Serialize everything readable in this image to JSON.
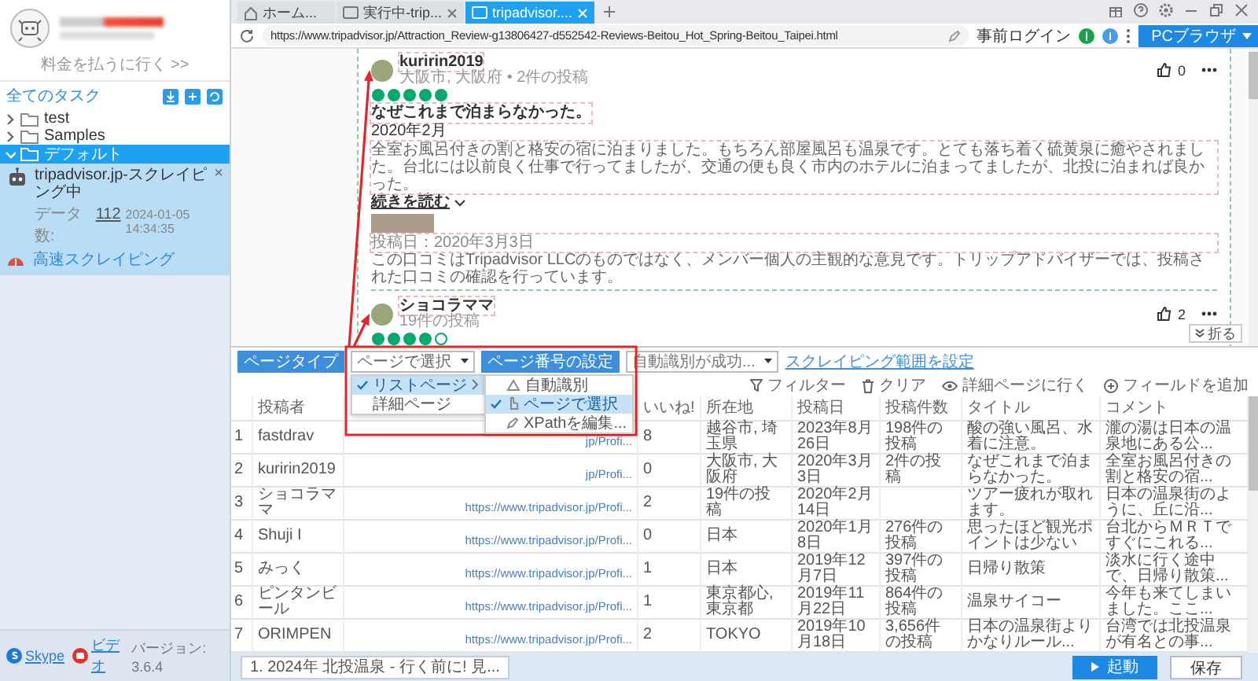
{
  "sidebar": {
    "account_link": "料金を払うに行く >>",
    "section_title": "全てのタスク",
    "folders": [
      {
        "label": "test",
        "expanded": false,
        "selected": false
      },
      {
        "label": "Samples",
        "expanded": false,
        "selected": false
      },
      {
        "label": "デフォルト",
        "expanded": true,
        "selected": true,
        "tasks": [
          {
            "title": "tripadvisor.jp-スクレイピング中",
            "data_label": "データ数:",
            "data_count": "112",
            "time": "2024-01-05 14:34:35",
            "mode": "高速スクレイピング",
            "close": "×"
          }
        ]
      }
    ],
    "footer": {
      "links": [
        {
          "kind": "skype",
          "label": "Skype"
        },
        {
          "kind": "video",
          "label": "ビデオ"
        }
      ],
      "version": "バージョン: 3.6.4"
    }
  },
  "browser": {
    "tabs": [
      {
        "kind": "home",
        "label": "ホーム...",
        "selected": false,
        "closable": false
      },
      {
        "kind": "page",
        "label": "実行中-trip...",
        "selected": false,
        "closable": true
      },
      {
        "kind": "page",
        "label": "tripadvisor....",
        "selected": true,
        "closable": true
      }
    ],
    "url": "https://www.tripadvisor.jp/Attraction_Review-g13806427-d552542-Reviews-Beitou_Hot_Spring-Beitou_Taipei.html",
    "login_button": "事前ログイン",
    "mode_button": "PCブラウザ"
  },
  "page": {
    "reviews": [
      {
        "author": "kuririn2019",
        "meta": "大阪市, 大阪府 • 2件の投稿",
        "likes": "0",
        "stars": 5,
        "title": "なぜこれまで泊まらなかった。",
        "date": "2020年2月",
        "body": "全室お風呂付きの割と格安の宿に泊まりました。もちろん部屋風呂も温泉です。とても落ち着く硫黄泉に癒やされました。台北には以前良く仕事で行ってましたが、交通の便も良く市内のホテルに泊まってましたが、北投に泊まれば良かった。",
        "read_more": "続きを読む",
        "photo": true,
        "posted": "投稿日：2020年3月3日",
        "disclaimer": "この口コミはTripadvisor LLCのものではなく、メンバー個人の主観的な意見です。トリップアドバイザーでは、投稿された口コミの確認を行っています。"
      },
      {
        "author": "ショコラママ",
        "meta": "19件の投稿",
        "likes": "2",
        "stars": 4
      }
    ],
    "collapse_button": "折る"
  },
  "panel": {
    "page_type_button": "ページタイプ",
    "page_type_select": "ページで選択",
    "page_number_button": "ページ番号の設定",
    "page_number_select": "自動識別が成功...",
    "range_link": "スクレイピング範囲を設定",
    "actions": [
      {
        "kind": "filter",
        "label": "フィルター"
      },
      {
        "kind": "clear",
        "label": "クリア"
      },
      {
        "kind": "detail",
        "label": "詳細ページに行く"
      },
      {
        "kind": "add",
        "label": "フィールドを追加"
      }
    ],
    "menu": [
      {
        "label": "リストページ",
        "selected": true,
        "has_submenu": true
      },
      {
        "label": "詳細ページ",
        "selected": false,
        "has_submenu": false
      }
    ],
    "submenu": [
      {
        "kind": "auto",
        "label": "自動識別",
        "selected": false
      },
      {
        "kind": "click",
        "label": "ページで選択",
        "selected": true
      },
      {
        "kind": "edit",
        "label": "XPathを編集...",
        "selected": false
      }
    ],
    "columns": [
      {
        "kind": "index"
      },
      {
        "kind": "text",
        "label": "投稿者"
      },
      {
        "kind": "link"
      },
      {
        "kind": "text",
        "label": "いいね!"
      },
      {
        "kind": "text",
        "label": "所在地"
      },
      {
        "kind": "text",
        "label": "投稿日"
      },
      {
        "kind": "text",
        "label": "投稿件数"
      },
      {
        "kind": "text",
        "label": "タイトル"
      },
      {
        "kind": "text",
        "label": "コメント"
      }
    ],
    "rows": [
      {
        "cells": [
          "1",
          "fastdrav",
          "jp/Profi...",
          "8",
          "越谷市, 埼玉県",
          "2023年8月26日",
          "198件の投稿",
          "酸の強い風呂、水着に注意。",
          "瀧の湯は日本の温泉地にある公..."
        ]
      },
      {
        "cells": [
          "2",
          "kuririn2019",
          "jp/Profi...",
          "0",
          "大阪市, 大阪府",
          "2020年3月3日",
          "2件の投稿",
          "なぜこれまで泊まらなかった。",
          "全室お風呂付きの割と格安の宿..."
        ]
      },
      {
        "cells": [
          "3",
          "ショコラママ",
          "https://www.tripadvisor.jp/Profi...",
          "2",
          "19件の投稿",
          "2020年2月14日",
          null,
          "ツアー疲れが取れます。",
          "日本の温泉街のように、丘に沿..."
        ]
      },
      {
        "cells": [
          "4",
          "Shuji I",
          "https://www.tripadvisor.jp/Profi...",
          "0",
          "日本",
          "2020年1月8日",
          "276件の投稿",
          "思ったほど観光ポイントは少ない",
          "台北からＭＲＴですぐにこれる..."
        ]
      },
      {
        "cells": [
          "5",
          "みっく",
          "https://www.tripadvisor.jp/Profi...",
          "1",
          "日本",
          "2019年12月7日",
          "397件の投稿",
          "日帰り散策",
          "淡水に行く途中で、日帰り散策..."
        ]
      },
      {
        "cells": [
          "6",
          "ピンタンビール",
          "https://www.tripadvisor.jp/Profi...",
          "1",
          "東京都心, 東京都",
          "2019年11月22日",
          "864件の投稿",
          "温泉サイコー",
          "今年も来てしまいました。ここ..."
        ]
      },
      {
        "cells": [
          "7",
          "ORIMPEN",
          "https://www.tripadvisor.jp/Profi...",
          "2",
          "TOKYO",
          "2019年10月18日",
          "3,656件の投稿",
          "日本の温泉街よりかなりルール...",
          "台湾では北投温泉が有名との事..."
        ]
      }
    ],
    "task_tab": "1. 2024年 北投温泉 - 行く前に! 見...",
    "start_button": "起動",
    "save_button": "保存"
  }
}
